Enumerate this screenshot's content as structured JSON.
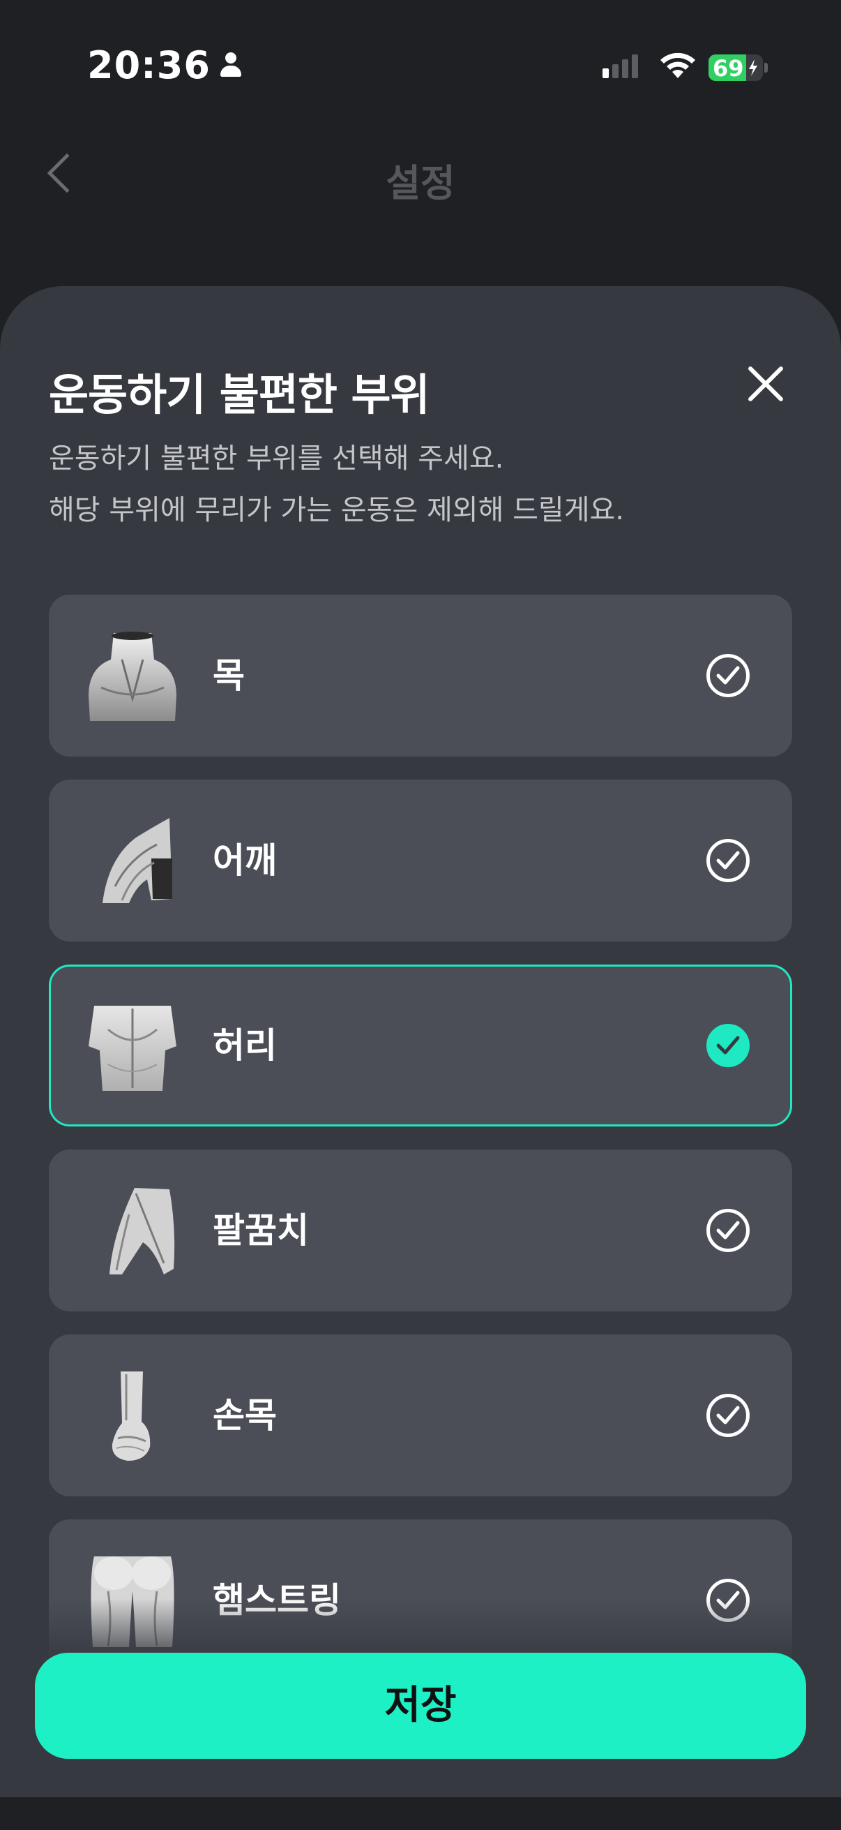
{
  "status_bar": {
    "time": "20:36",
    "battery_level": "69",
    "signal_bars_active": 1
  },
  "background": {
    "title": "설정"
  },
  "sheet": {
    "title": "운동하기 불편한 부위",
    "description_line1": "운동하기 불편한 부위를 선택해 주세요.",
    "description_line2": "해당 부위에 무리가 가는 운동은 제외해 드릴게요.",
    "items": [
      {
        "label": "목",
        "selected": false,
        "icon": "neck-muscle-icon"
      },
      {
        "label": "어깨",
        "selected": false,
        "icon": "shoulder-muscle-icon"
      },
      {
        "label": "허리",
        "selected": true,
        "icon": "back-muscle-icon"
      },
      {
        "label": "팔꿈치",
        "selected": false,
        "icon": "elbow-muscle-icon"
      },
      {
        "label": "손목",
        "selected": false,
        "icon": "wrist-muscle-icon"
      },
      {
        "label": "햄스트링",
        "selected": false,
        "icon": "hamstring-muscle-icon"
      }
    ],
    "save_label": "저장"
  },
  "colors": {
    "accent": "#1ee9c2",
    "sheet_bg": "#363940",
    "card_bg": "#4b4e57"
  }
}
